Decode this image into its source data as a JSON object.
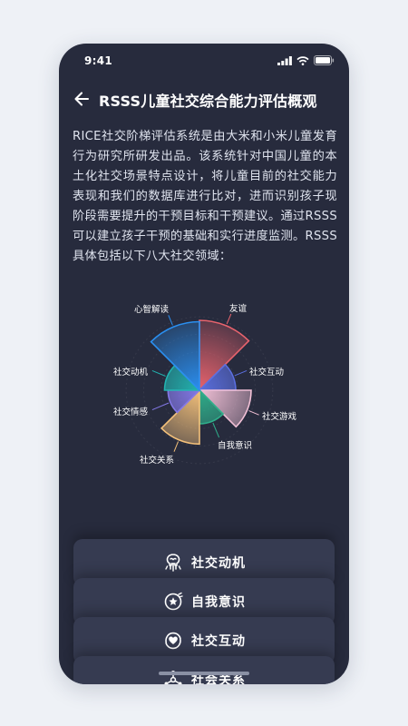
{
  "status": {
    "time": "9:41"
  },
  "header": {
    "title": "RSSS儿童社交综合能力评估概观"
  },
  "intro": "RICE社交阶梯评估系统是由大米和小米儿童发育行为研究所研发出品。该系统针对中国儿童的本土化社交场景特点设计，将儿童目前的社交能力表现和我们的数据库进行比对，进而识别孩子现阶段需要提升的干预目标和干预建议。通过RSSS可以建立孩子干预的基础和实行进度监测。RSSS具体包括以下八大社交领域：",
  "chart_data": {
    "type": "pie",
    "categories": [
      "友谊",
      "社交互动",
      "社交游戏",
      "自我意识",
      "社交关系",
      "社交情感",
      "社交动机",
      "心智解读"
    ],
    "values": [
      1.0,
      0.52,
      0.74,
      0.48,
      0.77,
      0.45,
      0.5,
      0.98
    ],
    "colors": [
      "#e8636d",
      "#5b6fe0",
      "#f1c0d6",
      "#2fae8a",
      "#f3c07a",
      "#8378e6",
      "#22b3b0",
      "#2a8ff0"
    ]
  },
  "cards": [
    {
      "label": "社交动机",
      "icon": "brain-icon"
    },
    {
      "label": "自我意识",
      "icon": "star-face-icon"
    },
    {
      "label": "社交互动",
      "icon": "heart-hands-icon"
    },
    {
      "label": "社会关系",
      "icon": "network-icon"
    }
  ]
}
